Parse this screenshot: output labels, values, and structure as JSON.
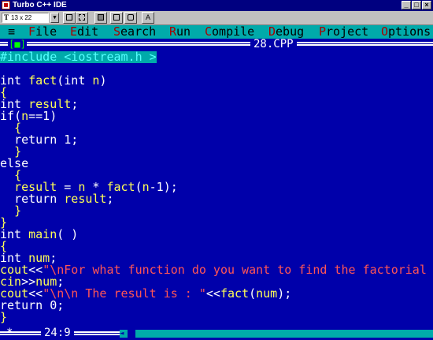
{
  "window": {
    "title": "Turbo C++ IDE",
    "controls": [
      "_",
      "□",
      "×"
    ]
  },
  "toolbar": {
    "font_prefix": "T",
    "font_size": "13 x 22",
    "dropdown_arrow": "▼",
    "buttons": [
      "copy-icon",
      "paste-icon",
      "fullscreen-icon",
      "properties-icon",
      "background-icon",
      "font-icon"
    ],
    "font_button_label": "A"
  },
  "menu": {
    "system": "≡",
    "items": [
      {
        "hot": "F",
        "rest": "ile"
      },
      {
        "hot": "E",
        "rest": "dit"
      },
      {
        "hot": "S",
        "rest": "earch"
      },
      {
        "hot": "R",
        "rest": "un"
      },
      {
        "hot": "C",
        "rest": "ompile"
      },
      {
        "hot": "D",
        "rest": "ebug"
      },
      {
        "hot": "P",
        "rest": "roject"
      },
      {
        "hot": "O",
        "rest": "ptions"
      }
    ]
  },
  "editor": {
    "close_box": "[■]",
    "filename": "28.CPP",
    "cursor_position": "24:9",
    "lines": [
      "#include <iostream.h >",
      "",
      "int fact(int n)",
      "{",
      "int result;",
      "if(n==1)",
      "  {",
      "  return 1;",
      "  }",
      "else",
      "  {",
      "  result = n * fact(n-1);",
      "  return result;",
      "  }",
      "}",
      "int main( )",
      "{",
      "int num;",
      "cout<<\"\\nFor what function do you want to find the factorial",
      "cin>>num;",
      "cout<<\"\\n\\n The result is : \"<<fact(num);",
      "return 0;",
      "}"
    ]
  },
  "colors": {
    "editor_bg": "#0000aa",
    "menu_bg": "#00aaaa",
    "hotkey": "#aa0000",
    "identifier": "#ffff55",
    "string": "#ff5555",
    "keyword": "#ffffff"
  }
}
